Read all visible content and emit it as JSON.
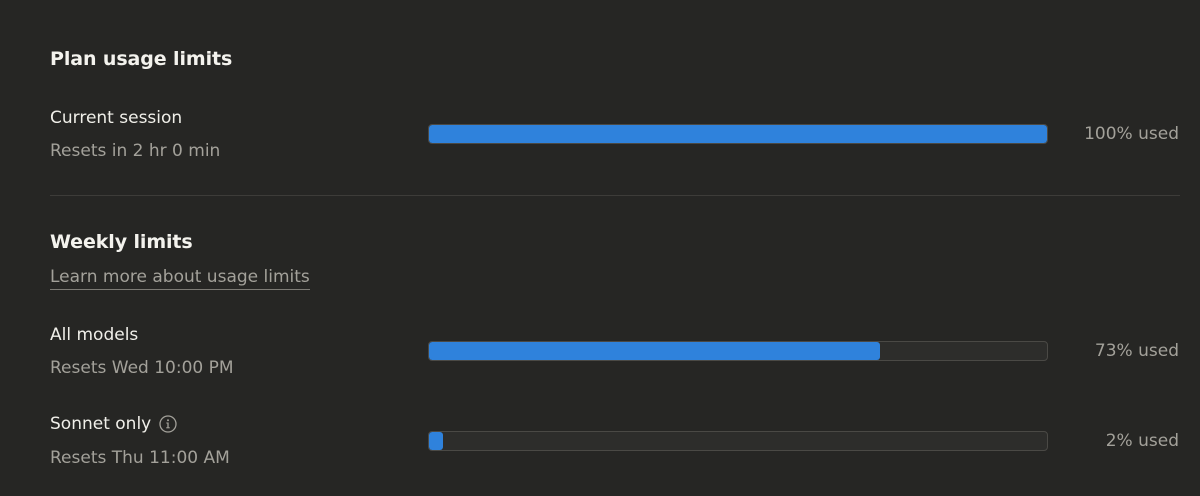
{
  "plan": {
    "title": "Plan usage limits",
    "current_session": {
      "label": "Current session",
      "reset": "Resets in 2 hr 0 min",
      "percent": 100,
      "used_text": "100% used"
    }
  },
  "weekly": {
    "title": "Weekly limits",
    "learn_more": "Learn more about usage limits",
    "all_models": {
      "label": "All models",
      "reset": "Resets Wed 10:00 PM",
      "percent": 73,
      "used_text": "73% used"
    },
    "sonnet_only": {
      "label": "Sonnet only",
      "reset": "Resets Thu 11:00 AM",
      "percent": 2,
      "used_text": "2% used",
      "icon": "info-icon"
    }
  },
  "colors": {
    "background": "#262624",
    "bar_fill": "#2f82dc",
    "bar_track": "#2d2d2b"
  }
}
